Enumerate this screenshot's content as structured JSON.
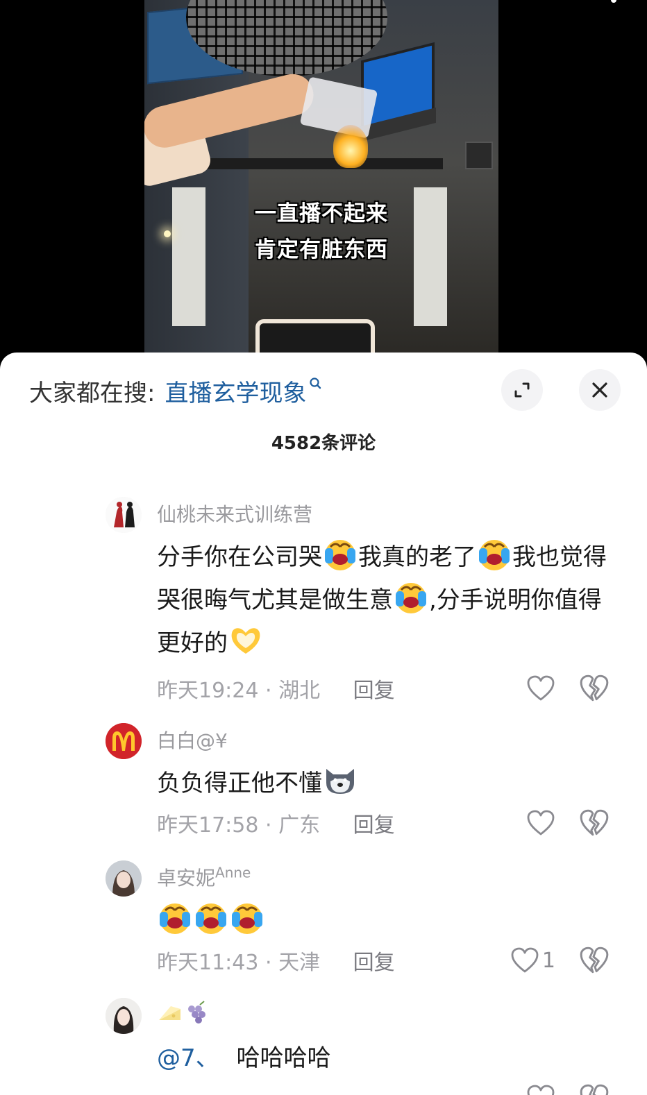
{
  "video": {
    "caption_line1": "一直播不起来",
    "caption_line2": "肯定有脏东西"
  },
  "search": {
    "label": "大家都在搜:",
    "term": "直播玄学现象"
  },
  "comments_header": {
    "count_text": "4582条评论"
  },
  "comments": [
    {
      "username": "仙桃未来式训练营",
      "segments": [
        "分手你在公司哭",
        "我真的老了",
        "我也觉得哭很晦气尤其是做生意",
        ",分手说明你值得更好的"
      ],
      "time": "昨天19:24",
      "location": "湖北",
      "reply_label": "回复",
      "likes": ""
    },
    {
      "username": "白白@¥",
      "segments": [
        "负负得正他不懂"
      ],
      "time": "昨天17:58",
      "location": "广东",
      "reply_label": "回复",
      "likes": ""
    },
    {
      "username": "卓安妮",
      "username_sup": "Anne",
      "segments": [],
      "time": "昨天11:43",
      "location": "天津",
      "reply_label": "回复",
      "likes": "1"
    },
    {
      "username": "",
      "mention": "@7、",
      "segments": [
        "哈哈哈哈"
      ],
      "time": "",
      "location": "",
      "reply_label": "",
      "likes": ""
    }
  ],
  "meta_separator": "·",
  "icons": {
    "search_hint": "search-icon",
    "expand": "expand-icon",
    "close": "close-icon",
    "like": "heart-icon",
    "dislike": "broken-heart-icon",
    "emoji_cry_laugh": "loudly-crying-emoji",
    "emoji_heart_hands": "heart-hands-emoji",
    "emoji_doge": "doge-emoji",
    "emoji_cheese": "cheese-emoji",
    "emoji_grapes": "grapes-emoji"
  },
  "colors": {
    "link_blue": "#1e5e9e",
    "meta_gray": "#a3a3a8",
    "sheet_bg": "#ffffff"
  }
}
